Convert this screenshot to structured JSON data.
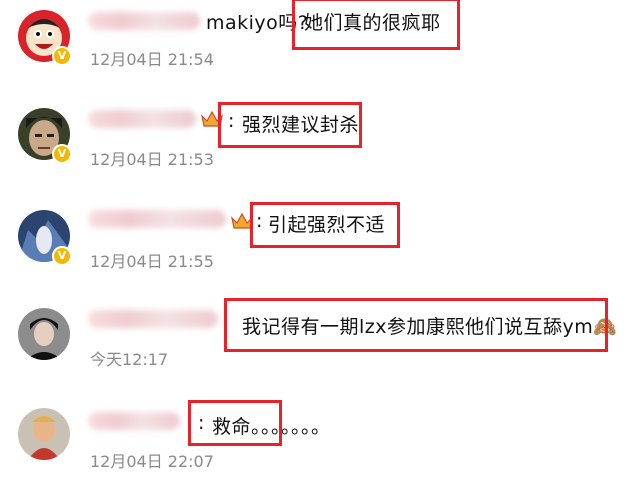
{
  "comments": [
    {
      "name_prefix": "makiyo吗?",
      "text": "她们真的很疯耶",
      "time": "12月04日 21:54",
      "verified_icon": "v-badge-icon"
    },
    {
      "name_prefix": ":",
      "text": "强烈建议封杀",
      "time": "12月04日 21:53",
      "verified_icon": "v-badge-icon",
      "rank_icon": "crown-icon"
    },
    {
      "name_prefix": ":",
      "text": "引起强烈不适",
      "time": "12月04日 21:55",
      "verified_icon": "v-badge-icon",
      "rank_icon": "crown-icon"
    },
    {
      "name_prefix": "",
      "text": "我记得有一期lzx参加康熙他们说互舔ym🙈",
      "time": "今天12:17",
      "verified_icon": ""
    },
    {
      "name_prefix": ":",
      "text": "救命。。。。。。。",
      "time": "12月04日 22:07",
      "verified_icon": ""
    }
  ],
  "colors": {
    "highlight": "#e8222a",
    "badge": "#f5b800",
    "time": "#8a8a8a"
  }
}
